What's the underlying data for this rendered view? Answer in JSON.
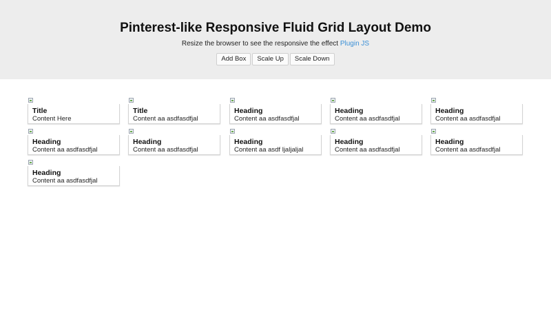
{
  "header": {
    "title": "Pinterest-like Responsive Fluid Grid Layout Demo",
    "subtitle": "Resize the browser to see the responsive the effect",
    "plugin_link": "Plugin JS",
    "buttons": {
      "add_box": "Add Box",
      "scale_up": "Scale Up",
      "scale_down": "Scale Down"
    }
  },
  "cards": [
    {
      "heading": "Title",
      "content": "Content Here"
    },
    {
      "heading": "Title",
      "content": "Content aa asdfasdfjal"
    },
    {
      "heading": "Heading",
      "content": "Content aa asdfasdfjal"
    },
    {
      "heading": "Heading",
      "content": "Content aa asdfasdfjal"
    },
    {
      "heading": "Heading",
      "content": "Content aa asdfasdfjal"
    },
    {
      "heading": "Heading",
      "content": "Content aa asdfasdfjal"
    },
    {
      "heading": "Heading",
      "content": "Content aa asdfasdfjal"
    },
    {
      "heading": "Heading",
      "content": "Content aa asdf ljaljaljal"
    },
    {
      "heading": "Heading",
      "content": "Content aa asdfasdfjal"
    },
    {
      "heading": "Heading",
      "content": "Content aa asdfasdfjal"
    },
    {
      "heading": "Heading",
      "content": "Content aa asdfasdfjal"
    }
  ]
}
